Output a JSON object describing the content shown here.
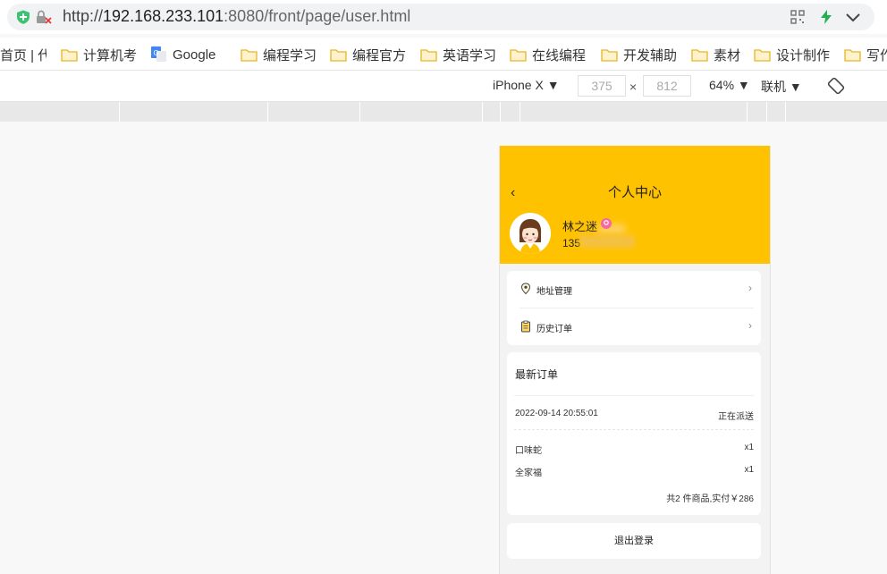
{
  "browser": {
    "url_prefix": "http://",
    "url_host": "192.168.233.101",
    "url_rest": ":8080/front/page/user.html"
  },
  "bookmarks": [
    {
      "label": "首页 | 代",
      "icon": "none"
    },
    {
      "label": "计算机考",
      "icon": "folder-icon"
    },
    {
      "label": "Google",
      "icon": "google-translate-icon"
    },
    {
      "label": "编程学习",
      "icon": "folder-icon"
    },
    {
      "label": "编程官方",
      "icon": "folder-icon"
    },
    {
      "label": "英语学习",
      "icon": "folder-icon"
    },
    {
      "label": "在线编程",
      "icon": "folder-icon"
    },
    {
      "label": "开发辅助",
      "icon": "folder-icon"
    },
    {
      "label": "素材",
      "icon": "folder-icon"
    },
    {
      "label": "设计制作",
      "icon": "folder-icon"
    },
    {
      "label": "写作",
      "icon": "folder-icon"
    }
  ],
  "devtools": {
    "device": "iPhone X ▼",
    "width": "375",
    "times": "×",
    "height": "812",
    "zoom": "64% ▼",
    "network": "联机 ▼"
  },
  "app": {
    "back_glyph": "‹",
    "title": "个人中心",
    "user_name": "林之迷",
    "user_phone": "135",
    "menu": [
      {
        "label": "地址管理",
        "icon": "location-pin-icon",
        "arrow": "›"
      },
      {
        "label": "历史订单",
        "icon": "clipboard-icon",
        "arrow": "›"
      }
    ],
    "latest_order": {
      "heading": "最新订单",
      "time": "2022-09-14 20:55:01",
      "status": "正在派送",
      "items": [
        {
          "name": "口味蛇",
          "qty": "x1"
        },
        {
          "name": "全家福",
          "qty": "x1"
        }
      ],
      "summary": "共2 件商品,实付￥286"
    },
    "logout": "退出登录"
  },
  "colors": {
    "accent": "#ffc200",
    "shield": "#3cc372",
    "bolt": "#22b14c"
  }
}
